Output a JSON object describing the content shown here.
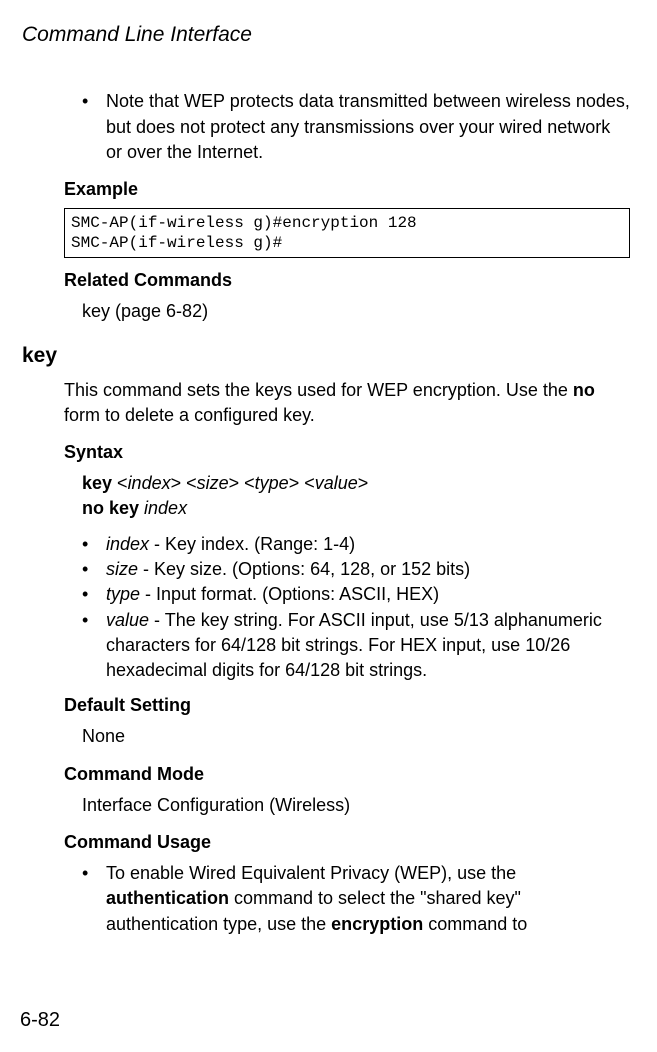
{
  "header": {
    "title": "Command Line Interface"
  },
  "note_bullet": {
    "marker": "•",
    "text": "Note that WEP protects data transmitted between wireless nodes, but does not protect any transmissions over your wired network or over the Internet."
  },
  "example_label": "Example",
  "example_code": "SMC-AP(if-wireless g)#encryption 128\nSMC-AP(if-wireless g)#",
  "related_label": "Related Commands",
  "related_text": "key (page 6-82)",
  "cmd": {
    "name": "key",
    "desc_1": "This command sets the keys used for WEP encryption. Use the ",
    "desc_no": "no",
    "desc_2": " form to delete a configured key.",
    "syntax_label": "Syntax",
    "syntax_line1_a": "key ",
    "syntax_line1_b": "<",
    "syntax_line1_c": "index",
    "syntax_line1_d": "> <",
    "syntax_line1_e": "size",
    "syntax_line1_f": "> <",
    "syntax_line1_g": "type",
    "syntax_line1_h": "> <",
    "syntax_line1_i": "value",
    "syntax_line1_j": ">",
    "syntax_line2_a": "no key ",
    "syntax_line2_b": "index",
    "params": [
      {
        "marker": "•",
        "name": "index",
        "rest": " - Key index. (Range: 1-4)"
      },
      {
        "marker": "•",
        "name": "size",
        "rest": " - Key size. (Options: 64, 128, or 152 bits)"
      },
      {
        "marker": "•",
        "name": "type",
        "rest": " - Input format. (Options: ASCII, HEX)"
      },
      {
        "marker": "•",
        "name": "value",
        "rest": " - The key string. For ASCII input, use 5/13 alphanumeric characters for 64/128 bit strings. For HEX input, use 10/26 hexadecimal digits for 64/128 bit strings."
      }
    ],
    "default_label": "Default Setting",
    "default_value": "None",
    "mode_label": "Command Mode",
    "mode_value": "Interface Configuration (Wireless)",
    "usage_label": "Command Usage",
    "usage_bullet": {
      "marker": "•",
      "t1": "To enable Wired Equivalent Privacy (WEP), use the ",
      "b1": "authentication",
      "t2": " command to select the \"shared key\" authentication type, use the ",
      "b2": "encryption",
      "t3": " command to"
    }
  },
  "page_number": "6-82"
}
